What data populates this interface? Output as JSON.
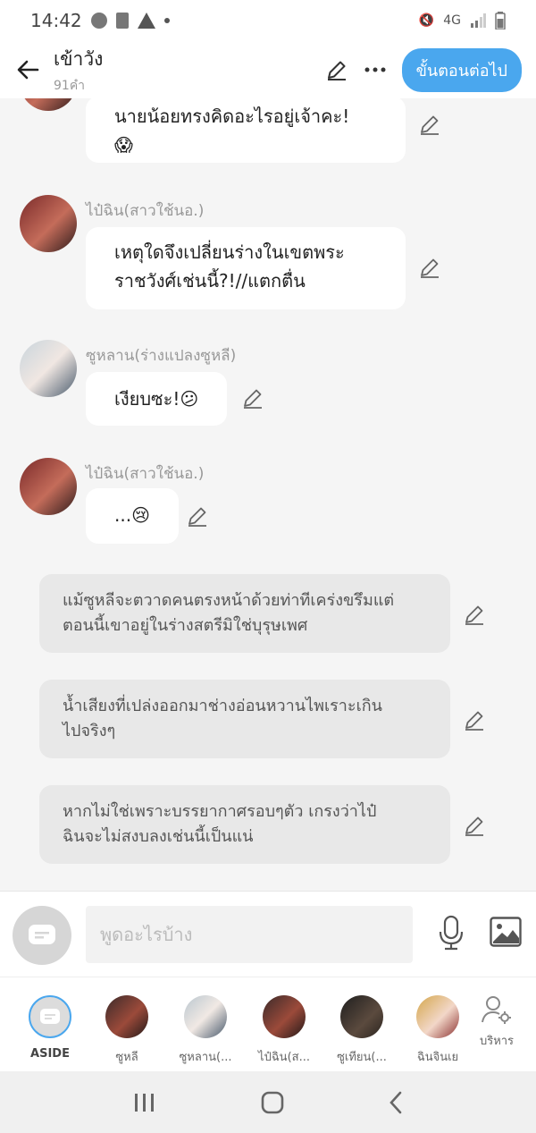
{
  "status": {
    "time": "14:42",
    "network": "4G"
  },
  "header": {
    "title": "เข้าวัง",
    "count": "91คำ",
    "next_label": "ขั้นตอนต่อไป"
  },
  "messages": [
    {
      "text_line1": "นายน้อยทรงคิดอะไรอยู่เจ้าคะ!",
      "emoji": "😱"
    },
    {
      "speaker": "ไป๋ฉิน(สาวใช้นอ.)",
      "text_line1": "เหตุใดจึงเปลี่ยนร่างในเขตพระ",
      "text_line2": "ราชวังศ์เช่นนี้?!//แตกตื่น"
    },
    {
      "speaker": "ซูหลาน(ร่างแปลงซูหลี)",
      "text_line1": "เงียบซะ!",
      "emoji": "😕"
    },
    {
      "speaker": "ไป๋ฉิน(สาวใช้นอ.)",
      "text_line1": "...",
      "emoji": "😢"
    }
  ],
  "narrations": [
    {
      "line1": "แม้ซูหลีจะตวาดคนตรงหน้าด้วยท่าทีเคร่งขรึมแต่",
      "line2": "ตอนนี้เขาอยู่ในร่างสตรีมิใช่บุรุษเพศ"
    },
    {
      "line1": "น้ำเสียงที่เปล่งออกมาช่างอ่อนหวานไพเราะเกิน",
      "line2": "ไปจริงๆ"
    },
    {
      "line1": "หากไม่ใช่เพราะบรรยากาศรอบๆตัว เกรงว่าไป๋",
      "line2": "ฉินจะไม่สงบลงเช่นนี้เป็นแน่"
    }
  ],
  "input": {
    "placeholder": "พูดอะไรบ้าง"
  },
  "characters": [
    {
      "label": "ASIDE"
    },
    {
      "label": "ซูหลี"
    },
    {
      "label": "ซูหลาน(..."
    },
    {
      "label": "ไป๋ฉิน(ส..."
    },
    {
      "label": "ซูเทียน(..."
    },
    {
      "label": "ฉินจินเย"
    }
  ],
  "manage_label": "บริหาร",
  "colors": {
    "accent": "#4aa7ee",
    "narration_bg": "#e8e8e8",
    "chat_bg": "#f5f5f5"
  }
}
